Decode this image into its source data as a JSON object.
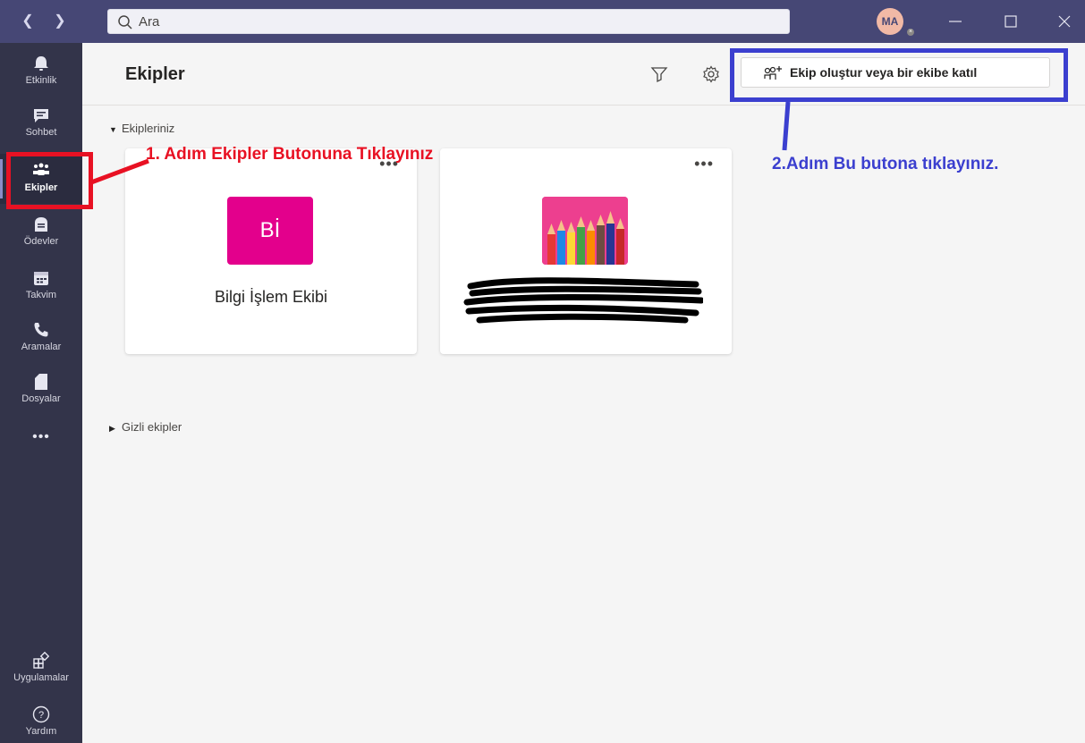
{
  "titlebar": {
    "search_placeholder": "Ara",
    "avatar_initials": "MA"
  },
  "rail": {
    "items": [
      {
        "label": "Etkinlik",
        "icon": "bell-icon"
      },
      {
        "label": "Sohbet",
        "icon": "chat-icon"
      },
      {
        "label": "Ekipler",
        "icon": "teams-icon",
        "active": true
      },
      {
        "label": "Ödevler",
        "icon": "assignments-icon"
      },
      {
        "label": "Takvim",
        "icon": "calendar-icon"
      },
      {
        "label": "Aramalar",
        "icon": "phone-icon"
      },
      {
        "label": "Dosyalar",
        "icon": "file-icon"
      }
    ],
    "more": "•••",
    "apps_label": "Uygulamalar",
    "help_label": "Yardım"
  },
  "main": {
    "title": "Ekipler",
    "create_button": "Ekip oluştur veya bir ekibe katıl",
    "section_yours": "Ekipleriniz",
    "section_hidden": "Gizli ekipler",
    "teams": [
      {
        "initials": "Bİ",
        "name": "Bilgi İşlem Ekibi",
        "tile_color": "#e3008c"
      },
      {
        "initials": "",
        "name": "",
        "tile_color": "#ed3f8f"
      }
    ],
    "more_dots": "•••"
  },
  "annotations": {
    "step1": "1. Adım Ekipler Butonuna Tıklayınız",
    "step2": "2.Adım Bu butona tıklayınız.",
    "step1_color": "#e81123",
    "step2_color": "#3b3fcf"
  },
  "colors": {
    "titlebar": "#464775",
    "rail": "#33344a",
    "brand": "#6264a7"
  }
}
